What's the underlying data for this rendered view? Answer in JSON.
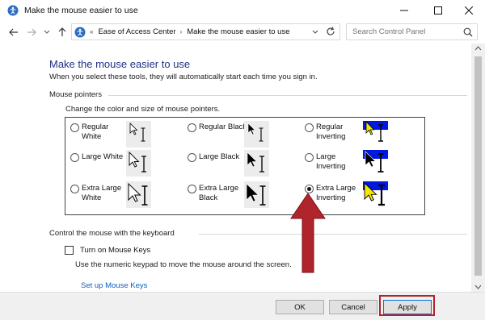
{
  "window": {
    "title": "Make the mouse easier to use",
    "controls": {
      "minimize": "—",
      "maximize": "☐",
      "close": "✕"
    }
  },
  "address_bar": {
    "overflow": "«",
    "crumbs": [
      "Ease of Access Center",
      "Make the mouse easier to use"
    ],
    "separator": "›"
  },
  "search": {
    "placeholder": "Search Control Panel"
  },
  "page": {
    "title": "Make the mouse easier to use",
    "description": "When you select these tools, they will automatically start each time you sign in."
  },
  "mouse_pointers": {
    "heading": "Mouse pointers",
    "subheading": "Change the color and size of mouse pointers.",
    "options": [
      {
        "label": "Regular White",
        "checked": false
      },
      {
        "label": "Regular Black",
        "checked": false
      },
      {
        "label": "Regular Inverting",
        "checked": false
      },
      {
        "label": "Large White",
        "checked": false
      },
      {
        "label": "Large Black",
        "checked": false
      },
      {
        "label": "Large Inverting",
        "checked": false
      },
      {
        "label": "Extra Large White",
        "checked": false
      },
      {
        "label": "Extra Large Black",
        "checked": false
      },
      {
        "label": "Extra Large Inverting",
        "checked": true
      }
    ]
  },
  "keyboard": {
    "heading": "Control the mouse with the keyboard",
    "mouse_keys_label": "Turn on Mouse Keys",
    "mouse_keys_checked": false,
    "mouse_keys_desc": "Use the numeric keypad to move the mouse around the screen.",
    "setup_link": "Set up Mouse Keys"
  },
  "buttons": {
    "ok": "OK",
    "cancel": "Cancel",
    "apply": "Apply"
  },
  "colors": {
    "title_blue": "#1e3287",
    "link_blue": "#0d5ec7",
    "arrow_red": "#b0242b",
    "invert_blue": "#0018e0",
    "invert_yellow": "#f5e800"
  }
}
